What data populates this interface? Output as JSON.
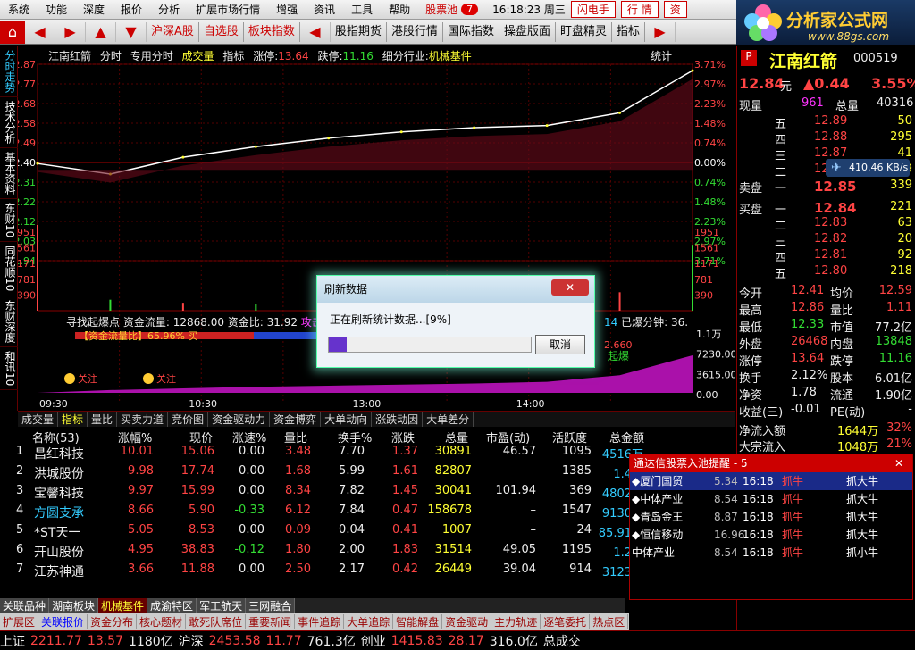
{
  "menu": {
    "items": [
      "系统",
      "功能",
      "深度",
      "报价",
      "分析",
      "扩展市场行情",
      "增强",
      "资讯",
      "工具",
      "帮助"
    ],
    "stock_pool": "股票池",
    "stock_pool_count": "7",
    "clock": "16:18:23 周三",
    "btn_flash": "闪电手",
    "btn_quote": "行 情",
    "btn_info": "资"
  },
  "brand": {
    "title": "分析家公式网",
    "url": "www.88gs.com"
  },
  "toolbar": {
    "items": [
      "沪深A股",
      "自选股",
      "板块指数",
      "股指期货",
      "港股行情",
      "国际指数",
      "操盘版面",
      "盯盘精灵",
      "指标"
    ]
  },
  "left_tabs": [
    "分时走势",
    "技术分析",
    "基本资料",
    "东财10",
    "同花顺10",
    "东财深度",
    "和讯10"
  ],
  "chart": {
    "header": {
      "name": "江南红箭",
      "mode": "分时",
      "special": "专用分时",
      "vol_label": "成交量",
      "indicator": "指标",
      "limit_up_label": "涨停:",
      "limit_up": "13.64",
      "limit_down_label": "跌停:",
      "limit_down": "11.16",
      "industry_label": "细分行业:",
      "industry": "机械基件",
      "stats": "统计"
    },
    "price_labels": [
      "12.87",
      "12.77",
      "12.68",
      "12.58",
      "12.49",
      "12.40",
      "12.31",
      "12.22",
      "12.12",
      "12.03",
      "11.94"
    ],
    "pct_labels": [
      "3.71%",
      "2.97%",
      "2.23%",
      "1.48%",
      "0.74%",
      "0.00%",
      "0.74%",
      "1.48%",
      "2.23%",
      "2.97%",
      "3.71%"
    ],
    "vol_labels": [
      "1951",
      "1561",
      "1171",
      "781",
      "390"
    ],
    "flow_labels": [
      "1.1万",
      "7230.00",
      "3615.00",
      "0.00"
    ],
    "time_labels": [
      "09:30",
      "10:30",
      "13:00",
      "14:00"
    ],
    "flow_header": {
      "prefix": "寻找起爆点",
      "capital_flow": "资金流量: 12868.00",
      "capital_ratio": "资金比: 31.92",
      "attack": "攻击",
      "right_val": "14",
      "exploded": "已爆分钟: 36."
    },
    "flow_bar": {
      "label": "【资金流量比】65.96% 买",
      "right": "2.660",
      "explode": "起爆"
    },
    "marks": [
      "关注",
      "关注"
    ]
  },
  "chart_data": [
    {
      "type": "line",
      "title": "",
      "xlabel": "",
      "ylabel": "",
      "x": [
        "09:30",
        "10:00",
        "10:30",
        "11:00",
        "11:30",
        "13:00",
        "13:30",
        "14:00",
        "14:30",
        "15:00"
      ],
      "series": [
        {
          "name": "",
          "values": [
            12.4,
            12.35,
            12.43,
            12.48,
            12.52,
            12.55,
            12.57,
            12.58,
            12.64,
            12.84
          ]
        }
      ],
      "ylim": [
        11.94,
        12.87
      ]
    },
    {
      "type": "bar",
      "title": "",
      "categories": [
        "09:30",
        "10:00",
        "10:30",
        "11:00",
        "11:30",
        "13:00",
        "13:30",
        "14:00",
        "14:30",
        "15:00"
      ],
      "values": [
        2200,
        250,
        180,
        160,
        150,
        170,
        180,
        200,
        420,
        1500
      ],
      "ylim": [
        0,
        1951
      ]
    },
    {
      "type": "area",
      "title": "",
      "x": [
        "09:30",
        "10:00",
        "10:30",
        "11:00",
        "11:30",
        "13:00",
        "13:30",
        "14:00",
        "14:30",
        "15:00"
      ],
      "series": [
        {
          "name": "",
          "values": [
            0,
            500,
            800,
            1100,
            1300,
            1500,
            1700,
            2000,
            3200,
            6800
          ]
        }
      ],
      "ylim": [
        0,
        11000
      ]
    }
  ],
  "bottom_tabs": [
    "成交量",
    "指标",
    "量比",
    "买卖力道",
    "竞价图",
    "资金驱动力",
    "资金博弈",
    "大单动向",
    "涨跌动因",
    "大单差分"
  ],
  "right_panel": {
    "name": "江南红箭",
    "code": "000519",
    "price": "12.84",
    "price_unit": "元",
    "change": "▲0.44",
    "change_pct": "3.55%",
    "now_vol_label": "现量",
    "now_vol": "961",
    "total_vol_label": "总量",
    "total_vol": "40316",
    "sell_label": "卖盘",
    "buy_label": "买盘",
    "sells": [
      {
        "lvl": "五",
        "price": "12.89",
        "vol": "50"
      },
      {
        "lvl": "四",
        "price": "12.88",
        "vol": "295"
      },
      {
        "lvl": "三",
        "price": "12.87",
        "vol": "41"
      },
      {
        "lvl": "二",
        "price": "12.86",
        "vol": "19"
      },
      {
        "lvl": "一",
        "price": "12.85",
        "vol": "339"
      }
    ],
    "buys": [
      {
        "lvl": "一",
        "price": "12.84",
        "vol": "221"
      },
      {
        "lvl": "二",
        "price": "12.83",
        "vol": "63"
      },
      {
        "lvl": "三",
        "price": "12.82",
        "vol": "20"
      },
      {
        "lvl": "四",
        "price": "12.81",
        "vol": "92"
      },
      {
        "lvl": "五",
        "price": "12.80",
        "vol": "218"
      }
    ],
    "stats": [
      {
        "l1": "今开",
        "v1": "12.41",
        "c1": "red",
        "l2": "均价",
        "v2": "12.59",
        "c2": "red"
      },
      {
        "l1": "最高",
        "v1": "12.86",
        "c1": "red",
        "l2": "量比",
        "v2": "1.11",
        "c2": "red"
      },
      {
        "l1": "最低",
        "v1": "12.33",
        "c1": "grn",
        "l2": "市值",
        "v2": "77.2亿",
        "c2": "wht"
      },
      {
        "l1": "外盘",
        "v1": "26468",
        "c1": "red",
        "l2": "内盘",
        "v2": "13848",
        "c2": "grn"
      },
      {
        "l1": "涨停",
        "v1": "13.64",
        "c1": "red",
        "l2": "跌停",
        "v2": "11.16",
        "c2": "grn"
      },
      {
        "l1": "换手",
        "v1": "2.12%",
        "c1": "wht",
        "l2": "股本",
        "v2": "6.01亿",
        "c2": "wht"
      },
      {
        "l1": "净资",
        "v1": "1.78",
        "c1": "wht",
        "l2": "流通",
        "v2": "1.90亿",
        "c2": "wht"
      },
      {
        "l1": "收益(三)",
        "v1": "-0.01",
        "c1": "wht",
        "l2": "PE(动)",
        "v2": "-",
        "c2": "wht"
      }
    ],
    "net_inflow_label": "净流入额",
    "net_inflow": "1644万",
    "net_inflow_pct": "32%",
    "big_inflow_label": "大宗流入",
    "big_inflow": "1048万",
    "big_inflow_pct": "21%"
  },
  "net_speed": "410.46 KB/s",
  "table": {
    "headers": [
      "名称(53)",
      "涨幅%",
      "现价",
      "涨速%",
      "量比",
      "换手%",
      "涨跌",
      "总量",
      "市盈(动)",
      "活跃度",
      "总金额"
    ],
    "rows": [
      {
        "no": "1",
        "name": "昌红科技",
        "pct": "10.01",
        "price": "15.06",
        "speed": "0.00",
        "vr": "3.48",
        "turn": "7.70",
        "chg": "1.37",
        "vol": "30891",
        "pe": "46.57",
        "act": "1095",
        "amt": "4516万",
        "nc": "wht"
      },
      {
        "no": "2",
        "name": "洪城股份",
        "pct": "9.98",
        "price": "17.74",
        "speed": "0.00",
        "vr": "1.68",
        "turn": "5.99",
        "chg": "1.61",
        "vol": "82807",
        "pe": "–",
        "act": "1385",
        "amt": "1.4亿",
        "nc": "wht"
      },
      {
        "no": "3",
        "name": "宝馨科技",
        "pct": "9.97",
        "price": "15.99",
        "speed": "0.00",
        "vr": "8.34",
        "turn": "7.82",
        "chg": "1.45",
        "vol": "30041",
        "pe": "101.94",
        "act": "369",
        "amt": "4802万",
        "nc": "wht"
      },
      {
        "no": "4",
        "name": "方圆支承",
        "pct": "8.66",
        "price": "5.90",
        "speed": "-0.33",
        "vr": "6.12",
        "turn": "7.84",
        "chg": "0.47",
        "vol": "158678",
        "pe": "–",
        "act": "1547",
        "amt": "9130万",
        "nc": "cya"
      },
      {
        "no": "5",
        "name": "*ST天一",
        "pct": "5.05",
        "price": "8.53",
        "speed": "0.00",
        "vr": "0.09",
        "turn": "0.04",
        "chg": "0.41",
        "vol": "1007",
        "pe": "–",
        "act": "24",
        "amt": "85.91万",
        "nc": "wht"
      },
      {
        "no": "6",
        "name": "开山股份",
        "pct": "4.95",
        "price": "38.83",
        "speed": "-0.12",
        "vr": "1.80",
        "turn": "2.00",
        "chg": "1.83",
        "vol": "31514",
        "pe": "49.05",
        "act": "1195",
        "amt": "1.2亿",
        "nc": "wht"
      },
      {
        "no": "7",
        "name": "江苏神通",
        "pct": "3.66",
        "price": "11.88",
        "speed": "0.00",
        "vr": "2.50",
        "turn": "2.17",
        "chg": "0.42",
        "vol": "26449",
        "pe": "39.04",
        "act": "914",
        "amt": "3123万",
        "nc": "wht"
      }
    ]
  },
  "popup": {
    "title": "通达信股票入池提醒 - 5",
    "rows": [
      {
        "name": "◆厦门国贸",
        "price": "5.34",
        "time": "16:18",
        "a": "抓牛",
        "b": "抓大牛"
      },
      {
        "name": "◆中体产业",
        "price": "8.54",
        "time": "16:18",
        "a": "抓牛",
        "b": "抓大牛"
      },
      {
        "name": "◆青岛金王",
        "price": "8.87",
        "time": "16:18",
        "a": "抓牛",
        "b": "抓大牛"
      },
      {
        "name": "◆恒信移动",
        "price": "16.96",
        "time": "16:18",
        "a": "抓牛",
        "b": "抓大牛"
      },
      {
        "name": "中体产业",
        "price": "8.54",
        "time": "16:18",
        "a": "抓牛",
        "b": "抓小牛"
      }
    ]
  },
  "sector_tabs": [
    "关联品种",
    "湖南板块",
    "机械基件",
    "成渝特区",
    "军工航天",
    "三网融合"
  ],
  "info_tabs": [
    "扩展区",
    "关联报价",
    "资金分布",
    "核心题材",
    "敢死队席位",
    "重要新闻",
    "事件追踪",
    "大单追踪",
    "智能解盘",
    "资金驱动",
    "主力轨迹",
    "逐笔委托",
    "热点区"
  ],
  "status": {
    "sh_label": "上证",
    "sh_val": "2211.77",
    "sh_chg": "13.57",
    "sh_amt": "1180亿",
    "sz_label": "沪深",
    "sz_val": "2453.58",
    "sz_chg": "11.77",
    "sz_amt": "761.3亿",
    "cy_label": "创业",
    "cy_val": "1415.83",
    "cy_chg": "28.17",
    "cy_amt": "316.0亿",
    "tail": "总成交"
  },
  "dialog": {
    "title": "刷新数据",
    "close": "✕",
    "message": "正在刷新统计数据...[9%]",
    "progress": 0.09,
    "cancel": "取消"
  }
}
